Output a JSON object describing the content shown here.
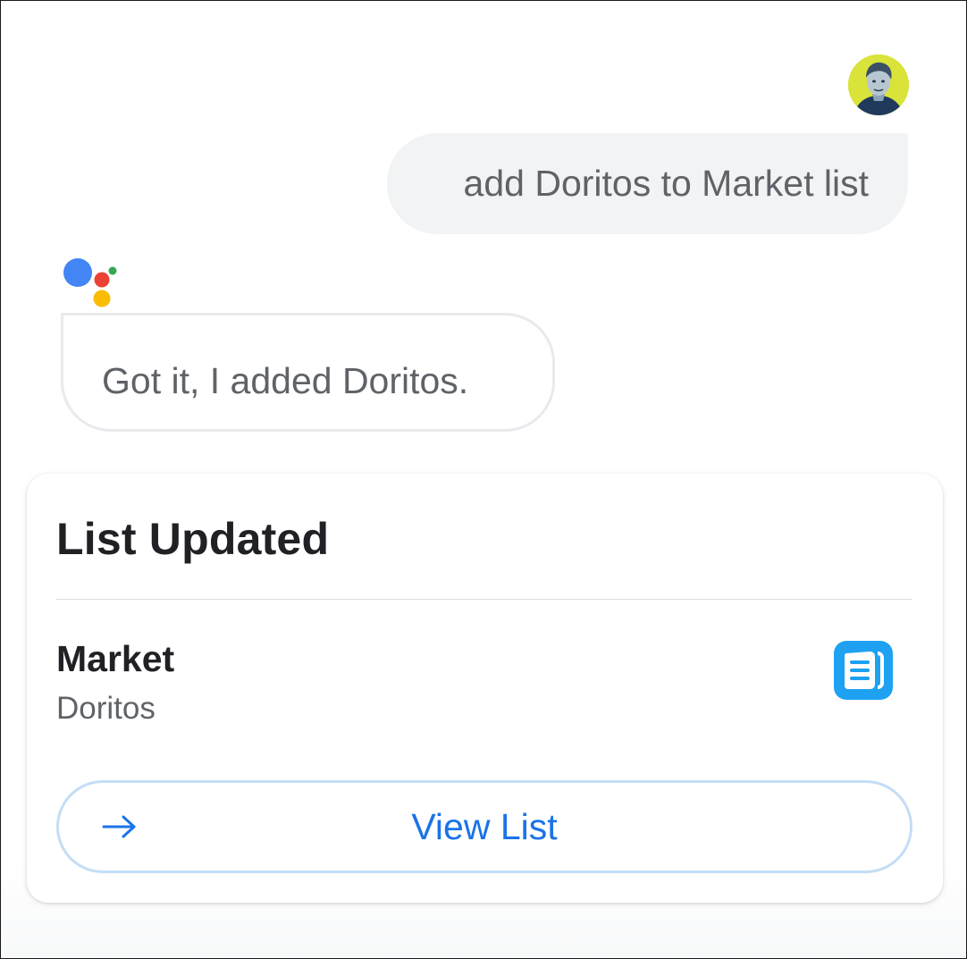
{
  "conversation": {
    "user_message": "add Doritos to Market list",
    "assistant_message": "Got it, I added Doritos."
  },
  "card": {
    "title": "List Updated",
    "list_name": "Market",
    "list_item": "Doritos",
    "button_label": "View List"
  },
  "icons": {
    "avatar": "user-avatar",
    "assistant": "google-assistant-dots-icon",
    "app": "list-app-icon",
    "button": "arrow-right-icon"
  },
  "colors": {
    "accent_blue": "#1a73e8",
    "assistant_blue": "#4285f4",
    "assistant_red": "#ea4335",
    "assistant_yellow": "#fbbc04",
    "assistant_green": "#34a853",
    "app_icon_blue": "#1ea1f1"
  }
}
